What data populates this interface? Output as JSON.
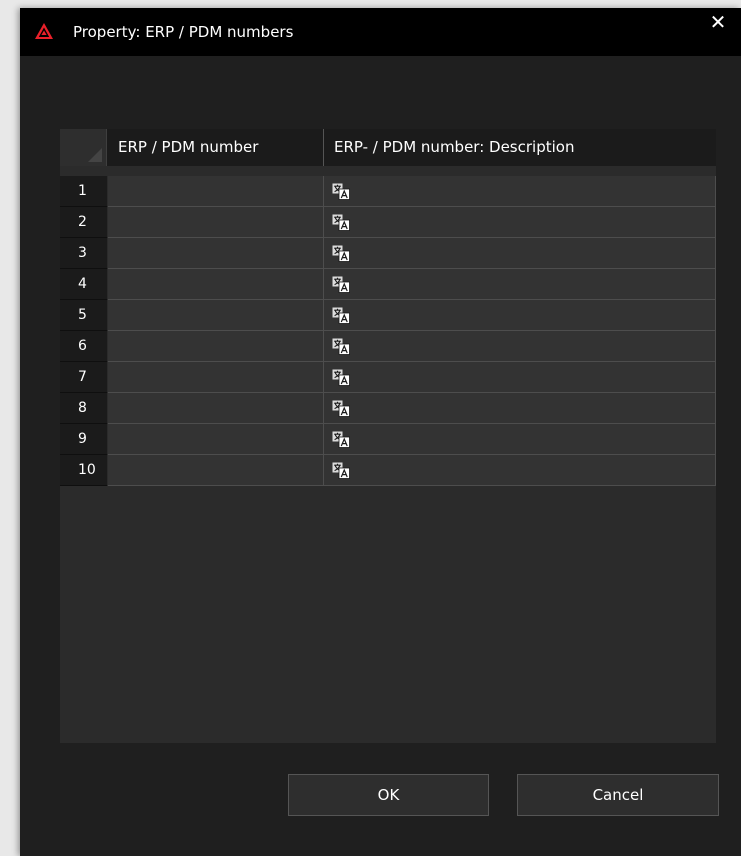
{
  "window": {
    "title": "Property: ERP / PDM numbers",
    "close_glyph": "✕",
    "logo_icon": "warning-triangle-logo",
    "logo_color": "#e8202a"
  },
  "table": {
    "columns": [
      "ERP / PDM number",
      "ERP- / PDM number: Description"
    ],
    "rows": [
      {
        "num": "1",
        "erp": "",
        "desc_icon": "translate-icon"
      },
      {
        "num": "2",
        "erp": "",
        "desc_icon": "translate-icon"
      },
      {
        "num": "3",
        "erp": "",
        "desc_icon": "translate-icon"
      },
      {
        "num": "4",
        "erp": "",
        "desc_icon": "translate-icon"
      },
      {
        "num": "5",
        "erp": "",
        "desc_icon": "translate-icon"
      },
      {
        "num": "6",
        "erp": "",
        "desc_icon": "translate-icon"
      },
      {
        "num": "7",
        "erp": "",
        "desc_icon": "translate-icon"
      },
      {
        "num": "8",
        "erp": "",
        "desc_icon": "translate-icon"
      },
      {
        "num": "9",
        "erp": "",
        "desc_icon": "translate-icon"
      },
      {
        "num": "10",
        "erp": "",
        "desc_icon": "translate-icon"
      }
    ]
  },
  "buttons": {
    "ok_label": "OK",
    "cancel_label": "Cancel"
  }
}
